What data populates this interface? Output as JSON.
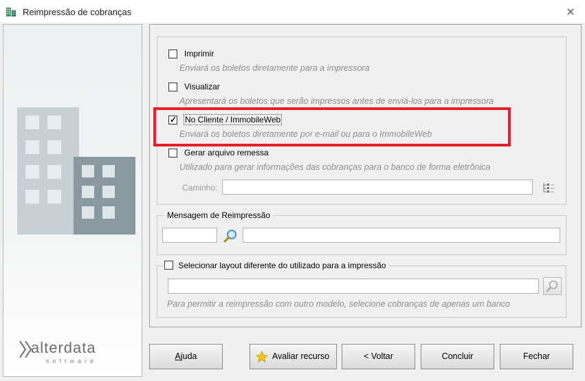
{
  "window": {
    "title": "Reimpressão de cobranças"
  },
  "brand": {
    "name": "alterdata",
    "sub": "software"
  },
  "options": {
    "imprimir": {
      "label": "Imprimir",
      "desc": "Enviará os boletos diretamente para a impressora",
      "checked": false
    },
    "visualizar": {
      "label": "Visualizar",
      "desc": "Apresentará os boletos que serão impressos antes de enviá-los para a impressora",
      "checked": false
    },
    "no_cliente": {
      "label": "No Cliente / ImmobileWeb",
      "desc": "Enviará os boletos diretamente por e-mail ou para o ImmobileWeb",
      "checked": true
    },
    "gerar_arquivo": {
      "label": "Gerar arquivo remessa",
      "desc": "Utilizado para gerar informações das cobranças para o banco de forma eletrônica",
      "checked": false
    },
    "caminho_label": "Caminho:",
    "caminho_value": ""
  },
  "mensagem": {
    "title": "Mensagem de Reimpressão",
    "code": "",
    "text": ""
  },
  "layout": {
    "label": "Selecionar layout diferente do utilizado para a impressão",
    "checked": false,
    "value": "",
    "hint": "Para permitir a reimpressão com outro modelo, selecione cobranças de apenas um banco"
  },
  "buttons": {
    "ajuda": "Ajuda",
    "avaliar": "Avaliar recurso",
    "voltar": "< Voltar",
    "concluir": "Concluir",
    "fechar": "Fechar"
  },
  "colors": {
    "highlight": "#e5202a",
    "hint": "#8e8e8e"
  }
}
